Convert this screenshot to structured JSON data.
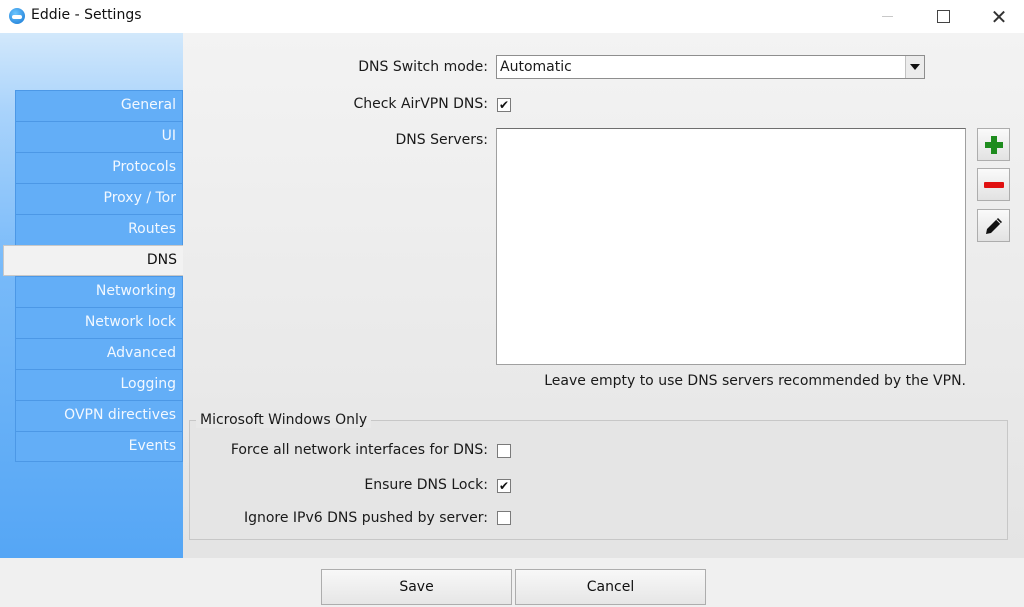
{
  "window": {
    "title": "Eddie - Settings",
    "controls": {
      "minimize": "minimize",
      "maximize": "maximize",
      "close": "✕"
    }
  },
  "sidebar": {
    "items": [
      {
        "label": "General",
        "active": false
      },
      {
        "label": "UI",
        "active": false
      },
      {
        "label": "Protocols",
        "active": false
      },
      {
        "label": "Proxy / Tor",
        "active": false
      },
      {
        "label": "Routes",
        "active": false
      },
      {
        "label": "DNS",
        "active": true
      },
      {
        "label": "Networking",
        "active": false
      },
      {
        "label": "Network lock",
        "active": false
      },
      {
        "label": "Advanced",
        "active": false
      },
      {
        "label": "Logging",
        "active": false
      },
      {
        "label": "OVPN directives",
        "active": false
      },
      {
        "label": "Events",
        "active": false
      }
    ]
  },
  "dns": {
    "switch_mode_label": "DNS Switch mode:",
    "switch_mode_value": "Automatic",
    "check_airvpn_label": "Check AirVPN DNS:",
    "check_airvpn_checked": true,
    "check_mark": "✔",
    "servers_label": "DNS Servers:",
    "servers": [],
    "add_icon": "plus-icon",
    "remove_icon": "minus-icon",
    "edit_icon": "pencil-icon",
    "hint": "Leave empty to use DNS servers recommended by the VPN.",
    "colors": {
      "add": "#1e8c1e",
      "remove": "#e01010",
      "edit": "#111111"
    }
  },
  "windows_group": {
    "title": "Microsoft Windows Only",
    "force_all_label": "Force all network interfaces for DNS:",
    "force_all_checked": false,
    "ensure_lock_label": "Ensure DNS Lock:",
    "ensure_lock_checked": true,
    "ignore_ipv6_label": "Ignore IPv6 DNS pushed by server:",
    "ignore_ipv6_checked": false
  },
  "footer": {
    "save_label": "Save",
    "cancel_label": "Cancel"
  }
}
